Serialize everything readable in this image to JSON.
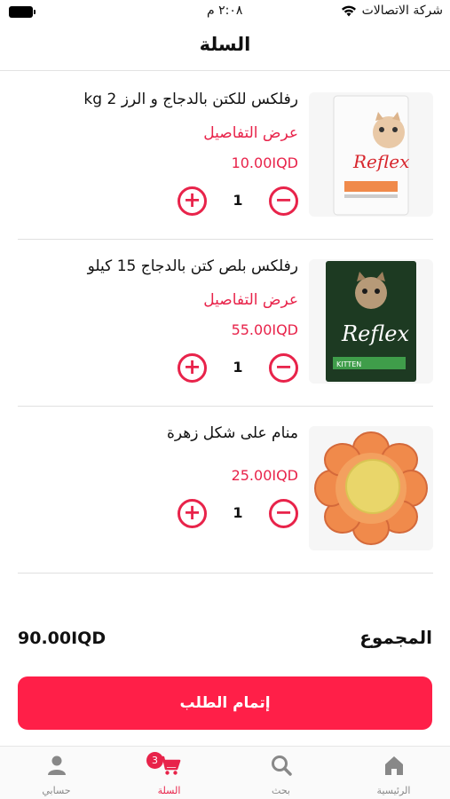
{
  "status_bar": {
    "carrier": "شركة الاتصالات",
    "time": "٢:٠٨ م"
  },
  "header": {
    "title": "السلة"
  },
  "cart": {
    "items": [
      {
        "name": "رفلكس للكتن بالدجاج و الرز 2 kg",
        "details_label": "عرض التفاصيل",
        "price": "10.00IQD",
        "quantity": "1",
        "image_brand": "Reflex"
      },
      {
        "name": "رفلكس بلص كتن بالدجاج 15 كيلو",
        "details_label": "عرض التفاصيل",
        "price": "55.00IQD",
        "quantity": "1",
        "image_brand": "Reflex",
        "image_sub": "KITTEN"
      },
      {
        "name": "منام على شكل زهرة",
        "price": "25.00IQD",
        "quantity": "1"
      }
    ],
    "plus_symbol": "+",
    "minus_symbol": "−"
  },
  "total": {
    "label": "المجموع",
    "value": "90.00IQD"
  },
  "checkout": {
    "label": "إتمام الطلب"
  },
  "tab_bar": {
    "tabs": [
      {
        "label": "الرئيسية",
        "icon": "home-icon"
      },
      {
        "label": "بحث",
        "icon": "search-icon"
      },
      {
        "label": "السلة",
        "icon": "cart-icon",
        "badge": "3"
      },
      {
        "label": "حسابي",
        "icon": "user-icon"
      }
    ]
  },
  "colors": {
    "accent": "#e8234a",
    "button": "#ff1f48"
  }
}
